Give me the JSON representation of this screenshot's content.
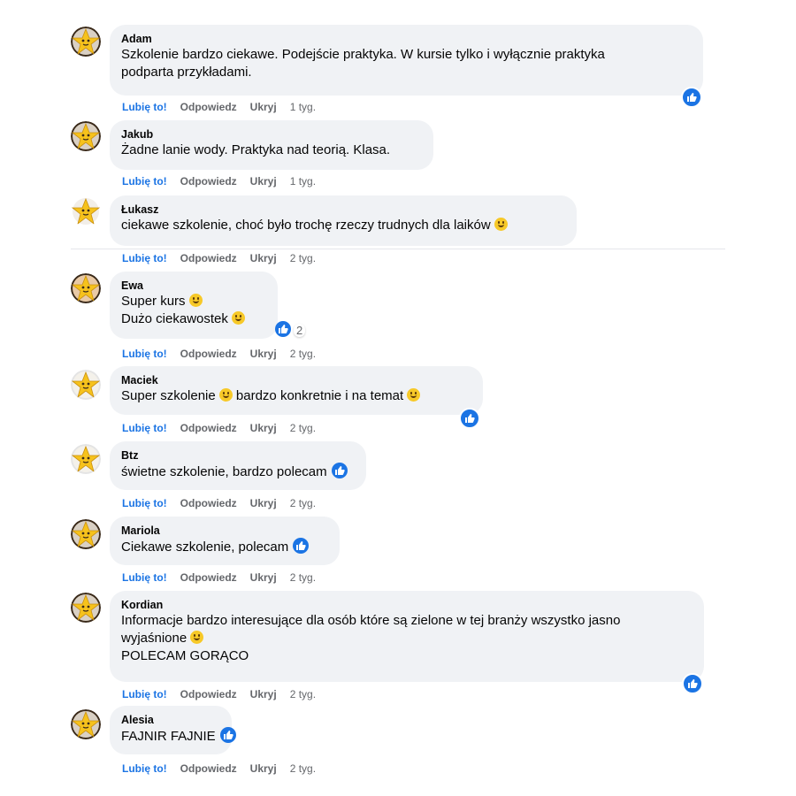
{
  "actions": {
    "like": "Lubię to!",
    "reply": "Odpowiedz",
    "hide": "Ukryj"
  },
  "colors": {
    "like_blue": "#1b74e4",
    "bubble_bg": "#f0f2f5",
    "meta_gray": "#65676b"
  },
  "comments": [
    {
      "author": "Adam",
      "lines": [
        "Szkolenie bardzo ciekawe. Podejście praktyka. W kursie tylko i wyłącznie praktyka",
        "podparta przykładami."
      ],
      "time": "1 tyg."
    },
    {
      "author": "Jakub",
      "lines": [
        "Żadne lanie wody. Praktyka nad teorią. Klasa."
      ],
      "time": "1 tyg."
    },
    {
      "author": "Łukasz",
      "lines": [
        "ciekawe szkolenie, choć było trochę rzeczy trudnych dla laików"
      ],
      "time": "2 tyg."
    },
    {
      "author": "Ewa",
      "lines": [
        "Super kurs",
        "Dużo ciekawostek"
      ],
      "reaction_count": "2",
      "time": "2 tyg."
    },
    {
      "author": "Maciek",
      "lines": [
        "Super szkolenie",
        "bardzo konkretnie i na temat"
      ],
      "time": "2 tyg."
    },
    {
      "author": "Btz",
      "lines": [
        "świetne szkolenie, bardzo polecam"
      ],
      "time": "2 tyg."
    },
    {
      "author": "Mariola",
      "lines": [
        "Ciekawe szkolenie, polecam"
      ],
      "time": "2 tyg."
    },
    {
      "author": "Kordian",
      "lines": [
        "Informacje bardzo interesujące dla osób które są zielone w tej branży wszystko jasno",
        "wyjaśnione",
        "POLECAM GORĄCO"
      ],
      "time": "2 tyg."
    },
    {
      "author": "Alesia",
      "lines": [
        "FAJNIR FAJNIE"
      ],
      "time": "2 tyg."
    }
  ]
}
